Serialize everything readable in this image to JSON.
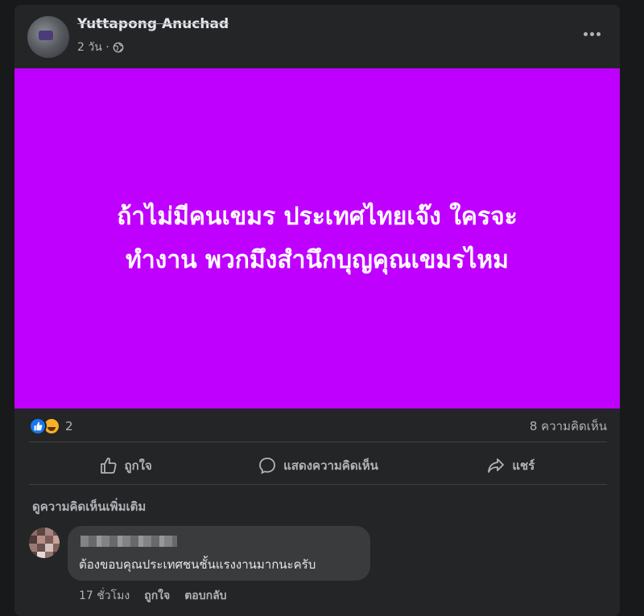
{
  "post": {
    "author_name": "Yuttapong Anuchad",
    "time_label": "2 วัน ·",
    "background_color": "#c000ff",
    "text": "ถ้าไม่มีคนเขมร ประเทศไทยเจ๊ง ใครจะ\nทำงาน พวกมึงสำนึกบุญคุณเขมรไหม"
  },
  "reactions": {
    "icons": [
      "like-icon",
      "haha-icon"
    ],
    "count": "2",
    "comments_label": "8 ความคิดเห็น"
  },
  "actions": {
    "like_label": "ถูกใจ",
    "comment_label": "แสดงความคิดเห็น",
    "share_label": "แชร์"
  },
  "comments": {
    "view_more_label": "ดูความคิดเห็นเพิ่มเติม",
    "items": [
      {
        "text": "ต้องขอบคุณประเทศชนชั้นแรงงานมากนะครับ",
        "time": "17 ชั่วโมง",
        "like_label": "ถูกใจ",
        "reply_label": "ตอบกลับ"
      }
    ]
  },
  "colors": {
    "background": "#18191a",
    "card": "#242526",
    "accent_like": "#1877f2",
    "post_background": "#c000ff"
  }
}
